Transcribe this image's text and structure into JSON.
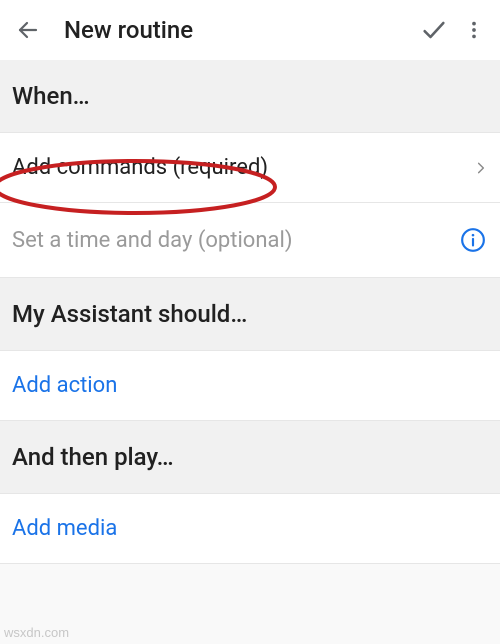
{
  "toolbar": {
    "title": "New routine"
  },
  "sections": {
    "when": "When…",
    "assistant": "My Assistant should…",
    "then": "And then play…"
  },
  "rows": {
    "add_commands": "Add commands (required)",
    "set_time": "Set a time and day (optional)",
    "add_action": "Add action",
    "add_media": "Add media"
  },
  "watermark": "wsxdn.com"
}
